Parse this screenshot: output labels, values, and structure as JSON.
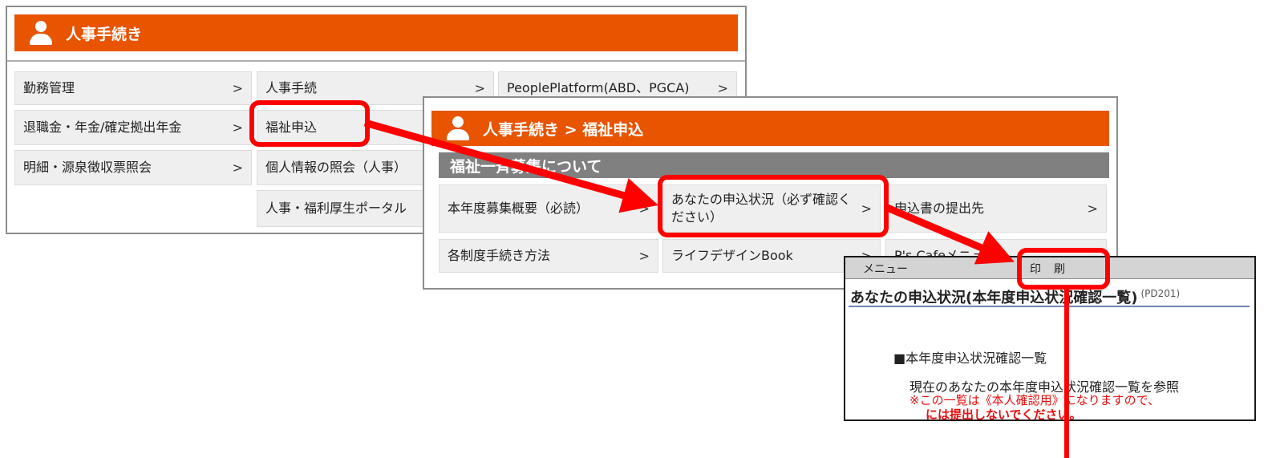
{
  "panel1": {
    "header_title": "人事手続き",
    "items": [
      {
        "label": "勤務管理",
        "chevron": ">"
      },
      {
        "label": "人事手続",
        "chevron": ">"
      },
      {
        "label": "PeoplePlatform(ABD、PGCA)",
        "chevron": ">"
      },
      {
        "label": "退職金・年金/確定拠出年金",
        "chevron": ">"
      },
      {
        "label": "福祉申込",
        "chevron": ""
      },
      {
        "label": "明細・源泉徴収票照会",
        "chevron": ">"
      },
      {
        "label": "個人情報の照会（人事）",
        "chevron": ""
      },
      {
        "label": "人事・福利厚生ポータル",
        "chevron": ""
      }
    ]
  },
  "panel2": {
    "header_title": "人事手続き > 福祉申込",
    "section_title": "福祉一斉募集について",
    "items": [
      {
        "label": "本年度募集概要（必読）",
        "chevron": ">"
      },
      {
        "label": "あなたの申込状況（必ず確認ください）",
        "chevron": ">"
      },
      {
        "label": "申込書の提出先",
        "chevron": ">"
      },
      {
        "label": "各制度手続き方法",
        "chevron": ">"
      },
      {
        "label": "ライフデザインBook",
        "chevron": ">"
      },
      {
        "label": "P's Cafeメニュー",
        "chevron": ""
      }
    ]
  },
  "panel3": {
    "menu_label": "メニュー",
    "print_label": "印刷",
    "page_title": "あなたの申込状況(本年度申込状況確認一覧)",
    "page_code": "(PD201)",
    "section_heading": "■本年度申込状況確認一覧",
    "body_text": "現在のあなたの本年度申込状況確認一覧を参照",
    "note_line1": "※この一覧は《本人確認用》になりますので、",
    "note_line2": "には提出しないでください。"
  },
  "colors": {
    "header_orange": "#e85400",
    "highlight_red": "#ff0000",
    "section_gray": "#808080",
    "cell_bg": "#efefef",
    "note_red": "#e81010"
  }
}
